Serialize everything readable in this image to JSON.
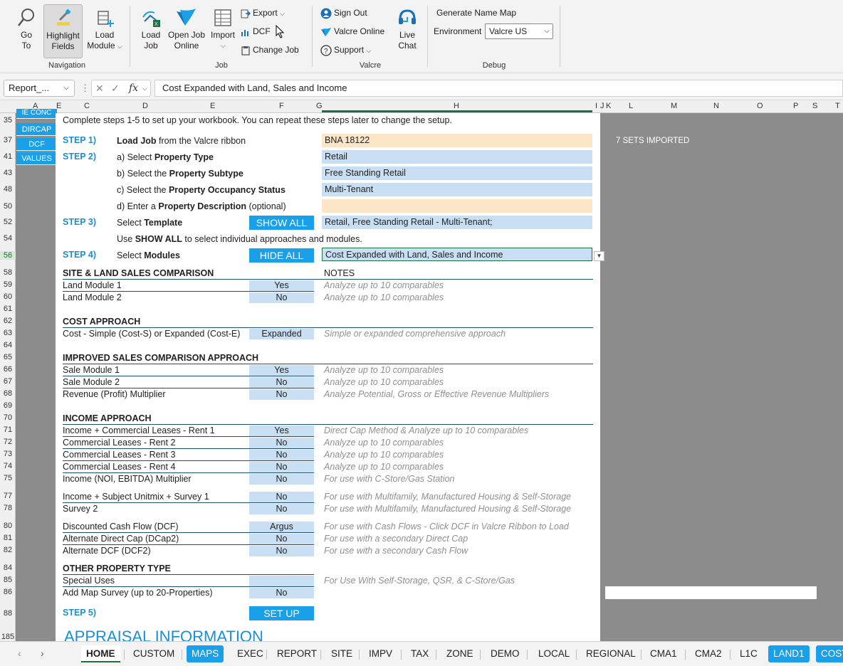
{
  "ribbon": {
    "navigation": {
      "label": "Navigation",
      "go_to": "Go\nTo",
      "go_to_l1": "Go",
      "go_to_l2": "To",
      "highlight_l1": "Highlight",
      "highlight_l2": "Fields",
      "load_module_l1": "Load",
      "load_module_l2": "Module"
    },
    "job": {
      "label": "Job",
      "load_job_l1": "Load",
      "load_job_l2": "Job",
      "open_job_l1": "Open Job",
      "open_job_l2": "Online",
      "import": "Import",
      "export": "Export",
      "dcf": "DCF",
      "change_job": "Change Job"
    },
    "valcre": {
      "label": "Valcre",
      "sign_out": "Sign Out",
      "valcre_online": "Valcre Online",
      "support": "Support",
      "live_chat_l1": "Live",
      "live_chat_l2": "Chat"
    },
    "debug": {
      "label": "Debug",
      "generate_name_map": "Generate Name Map",
      "environment_label": "Environment",
      "environment_value": "Valcre US"
    }
  },
  "formula_bar": {
    "name_box": "Report_...",
    "formula": "Cost Expanded with Land, Sales and Income"
  },
  "columns": [
    "A",
    "E",
    "C",
    "D",
    "E",
    "F",
    "G",
    "H",
    "I",
    "J",
    "K",
    "L",
    "M",
    "N",
    "O",
    "P",
    "S",
    "T"
  ],
  "rows": [
    "35",
    "37",
    "41",
    "43",
    "48",
    "50",
    "52",
    "54",
    "56",
    "58",
    "59",
    "60",
    "61",
    "62",
    "63",
    "64",
    "65",
    "66",
    "67",
    "68",
    "69",
    "70",
    "71",
    "72",
    "73",
    "74",
    "75",
    "77",
    "78",
    "80",
    "81",
    "82",
    "84",
    "85",
    "86",
    "88",
    "185"
  ],
  "nav_buttons": [
    "IE CONC",
    "DIRCAP",
    "DCF",
    "VALUES"
  ],
  "intro": "Complete steps 1-5 to set up your workbook. You can repeat these steps later to change the setup.",
  "steps": {
    "s1": "STEP 1)",
    "s2": "STEP 2)",
    "s3": "STEP 3)",
    "s4": "STEP 4)",
    "s5": "STEP 5)",
    "load_job_b": "Load Job",
    "load_job_r": " from the Valcre ribbon",
    "a_pre": "a) Select ",
    "a_b": "Property Type",
    "b_pre": "b) Select the ",
    "b_b": "Property Subtype",
    "c_pre": "c) Select the ",
    "c_b": "Property Occupancy Status",
    "d_pre": "d) Enter a ",
    "d_b": "Property Description",
    "d_post": " (optional)",
    "template_pre": "Select ",
    "template_b": "Template",
    "use_pre": "Use ",
    "use_b": "SHOW ALL",
    "use_post": " to select individual approaches and modules.",
    "modules_pre": "Select ",
    "modules_b": "Modules",
    "show_all": "SHOW ALL",
    "hide_all": "HIDE ALL",
    "set_up": "SET UP"
  },
  "fields": {
    "job": "BNA 18122",
    "type": "Retail",
    "subtype": "Free Standing Retail",
    "occupancy": "Multi-Tenant",
    "description": "",
    "template": "Retail, Free Standing Retail - Multi-Tenant;",
    "modules": "Cost Expanded with Land, Sales and Income"
  },
  "sets_imported": "7 SETS IMPORTED",
  "notes_header": "NOTES",
  "sections": {
    "site": "SITE & LAND SALES COMPARISON",
    "cost": "COST APPROACH",
    "sales": "IMPROVED SALES COMPARISON APPROACH",
    "income": "INCOME APPROACH",
    "other": "OTHER PROPERTY TYPE"
  },
  "modules": [
    {
      "label": "Land Module 1",
      "value": "Yes",
      "note": "Analyze up to 10 comparables"
    },
    {
      "label": "Land Module 2",
      "value": "No",
      "note": "Analyze up to 10 comparables"
    },
    {
      "label": "Cost - Simple (Cost-S) or Expanded (Cost-E)",
      "value": "Expanded",
      "note": "Simple or expanded comprehensive approach"
    },
    {
      "label": "Sale Module 1",
      "value": "Yes",
      "note": "Analyze up to 10 comparables"
    },
    {
      "label": "Sale Module 2",
      "value": "No",
      "note": "Analyze up to 10 comparables"
    },
    {
      "label": "Revenue (Profit) Multiplier",
      "value": "No",
      "note": "Analyze Potential, Gross or Effective Revenue Multipliers"
    },
    {
      "label": "Income + Commercial Leases - Rent 1",
      "value": "Yes",
      "note": "Direct Cap Method & Analyze up to 10 comparables"
    },
    {
      "label": "Commercial Leases - Rent 2",
      "value": "No",
      "note": "Analyze up to 10 comparables"
    },
    {
      "label": "Commercial Leases - Rent 3",
      "value": "No",
      "note": "Analyze up to 10 comparables"
    },
    {
      "label": "Commercial Leases - Rent 4",
      "value": "No",
      "note": "Analyze up to 10 comparables"
    },
    {
      "label": "Income (NOI, EBITDA) Multiplier",
      "value": "No",
      "note": "For use with C-Store/Gas Station"
    },
    {
      "label": "Income + Subject Unitmix + Survey 1",
      "value": "No",
      "note": "For use with Multifamily, Manufactured Housing & Self-Storage"
    },
    {
      "label": "Survey 2",
      "value": "No",
      "note": "For use with Multifamily, Manufactured Housing & Self-Storage"
    },
    {
      "label": "Discounted Cash Flow (DCF)",
      "value": "Argus",
      "note": "For use with Cash Flows - Click DCF in Valcre Ribbon to Load"
    },
    {
      "label": "Alternate Direct Cap (DCap2)",
      "value": "No",
      "note": "For use with a secondary Direct Cap"
    },
    {
      "label": "Alternate DCF (DCF2)",
      "value": "No",
      "note": "For use with a secondary Cash Flow"
    },
    {
      "label": "Special Uses",
      "value": "",
      "note": "For Use With Self-Storage, QSR, & C-Store/Gas"
    },
    {
      "label": "Add Map Survey (up to 20-Properties)",
      "value": "No",
      "note": ""
    }
  ],
  "appraisal_heading": "APPRAISAL INFORMATION",
  "sheet_tabs": [
    "HOME",
    "CUSTOM",
    "MAPS",
    "EXEC",
    "REPORT",
    "SITE",
    "IMPV",
    "TAX",
    "ZONE",
    "DEMO",
    "LOCAL",
    "REGIONAL",
    "CMA1",
    "CMA2",
    "L1C",
    "LAND1",
    "COST"
  ],
  "colors": {
    "accent": "#1aa0e8",
    "field": "#c9dff3",
    "peach": "#fde6c8",
    "section_line": "#1f4e79"
  }
}
